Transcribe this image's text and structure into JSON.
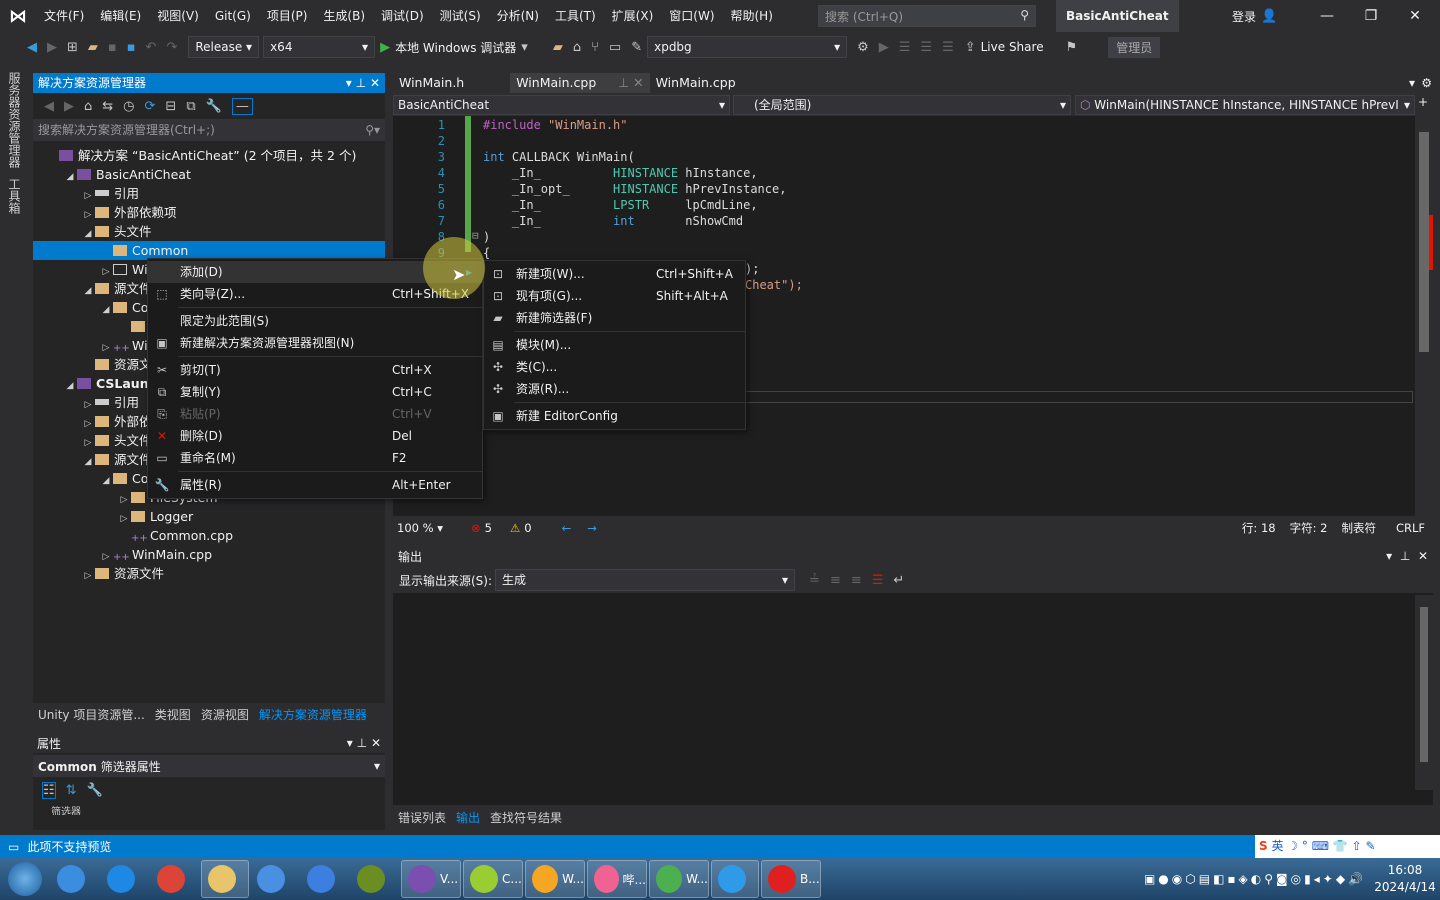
{
  "app": {
    "project_title": "BasicAntiCheat",
    "login": "登录",
    "colors": {
      "accent": "#007acc",
      "bg": "#2d2d30",
      "editor_bg": "#1e1e1e"
    }
  },
  "menu": [
    "文件(F)",
    "编辑(E)",
    "视图(V)",
    "Git(G)",
    "项目(P)",
    "生成(B)",
    "调试(D)",
    "测试(S)",
    "分析(N)",
    "工具(T)",
    "扩展(X)",
    "窗口(W)",
    "帮助(H)"
  ],
  "search": {
    "placeholder": "搜索 (Ctrl+Q)"
  },
  "toolbar": {
    "config": "Release",
    "platform": "x64",
    "run_label": "本地 Windows 调试器",
    "debugger": "xpdbg",
    "live_share": "Live Share",
    "admin": "管理员"
  },
  "left_tabs": [
    "服务器资源管理器",
    "工具箱"
  ],
  "solution_explorer": {
    "title": "解决方案资源管理器",
    "search_placeholder": "搜索解决方案资源管理器(Ctrl+;)",
    "items": [
      {
        "label": "解决方案 “BasicAntiCheat” (2 个项目，共 2 个)",
        "indent": 0,
        "arrow": "",
        "icon": "solution"
      },
      {
        "label": "BasicAntiCheat",
        "indent": 1,
        "arrow": "◢",
        "icon": "proj"
      },
      {
        "label": "引用",
        "indent": 2,
        "arrow": "▷",
        "icon": "ref"
      },
      {
        "label": "外部依赖项",
        "indent": 2,
        "arrow": "▷",
        "icon": "folder"
      },
      {
        "label": "头文件",
        "indent": 2,
        "arrow": "◢",
        "icon": "folder"
      },
      {
        "label": "Common",
        "indent": 3,
        "arrow": "",
        "icon": "folder",
        "selected": true
      },
      {
        "label": "Win",
        "indent": 3,
        "arrow": "▷",
        "icon": "file"
      },
      {
        "label": "源文件",
        "indent": 2,
        "arrow": "◢",
        "icon": "folder"
      },
      {
        "label": "Com",
        "indent": 3,
        "arrow": "◢",
        "icon": "folder"
      },
      {
        "label": "F",
        "indent": 4,
        "arrow": "",
        "icon": "folder"
      },
      {
        "label": "Win",
        "indent": 3,
        "arrow": "▷",
        "icon": "cpp"
      },
      {
        "label": "资源文件",
        "indent": 2,
        "arrow": "",
        "icon": "folder"
      },
      {
        "label": "CSLaunch",
        "indent": 1,
        "arrow": "◢",
        "icon": "proj",
        "bold": true
      },
      {
        "label": "引用",
        "indent": 2,
        "arrow": "▷",
        "icon": "ref"
      },
      {
        "label": "外部依赖",
        "indent": 2,
        "arrow": "▷",
        "icon": "folder"
      },
      {
        "label": "头文件",
        "indent": 2,
        "arrow": "▷",
        "icon": "folder"
      },
      {
        "label": "源文件",
        "indent": 2,
        "arrow": "◢",
        "icon": "folder"
      },
      {
        "label": "Com",
        "indent": 3,
        "arrow": "◢",
        "icon": "folder"
      },
      {
        "label": "FileSystem",
        "indent": 4,
        "arrow": "▷",
        "icon": "folder"
      },
      {
        "label": "Logger",
        "indent": 4,
        "arrow": "▷",
        "icon": "folder"
      },
      {
        "label": "Common.cpp",
        "indent": 4,
        "arrow": "",
        "icon": "cpp"
      },
      {
        "label": "WinMain.cpp",
        "indent": 3,
        "arrow": "▷",
        "icon": "cpp"
      },
      {
        "label": "资源文件",
        "indent": 2,
        "arrow": "▷",
        "icon": "folder"
      }
    ],
    "tabs": [
      "Unity 项目资源管...",
      "类视图",
      "资源视图",
      "解决方案资源管理器"
    ]
  },
  "properties": {
    "title": "属性",
    "object": "Common",
    "object_type": "筛选器属性",
    "row": "筛选器"
  },
  "editor": {
    "tabs": [
      "WinMain.h",
      "WinMain.cpp",
      "WinMain.cpp"
    ],
    "nav": [
      "BasicAntiCheat",
      "(全局范围)",
      "WinMain(HINSTANCE hInstance, HINSTANCE hPrevI"
    ],
    "line_numbers": [
      "1",
      "2",
      "3",
      "4",
      "5",
      "6",
      "7",
      "8",
      "9"
    ],
    "lines": [
      [
        [
          "mc",
          "#include "
        ],
        [
          "st",
          "\"WinMain.h\""
        ]
      ],
      [],
      [
        [
          "kw",
          "int "
        ],
        [
          "",
          "CALLBACK WinMain("
        ]
      ],
      [
        [
          "",
          "    _In_          "
        ],
        [
          "ty",
          "HINSTANCE "
        ],
        [
          "",
          "hInstance,"
        ]
      ],
      [
        [
          "",
          "    _In_opt_      "
        ],
        [
          "ty",
          "HINSTANCE "
        ],
        [
          "",
          "hPrevInstance,"
        ]
      ],
      [
        [
          "",
          "    _In_          "
        ],
        [
          "ty",
          "LPSTR     "
        ],
        [
          "",
          "lpCmdLine,"
        ]
      ],
      [
        [
          "",
          "    _In_          "
        ],
        [
          "kw",
          "int       "
        ],
        [
          "",
          "nShowCmd"
        ]
      ],
      [
        [
          "",
          ")"
        ]
      ],
      [
        [
          "",
          "{"
        ]
      ]
    ],
    "partial_lines": [
      ");",
      "Cheat\");"
    ],
    "zoom": "100 %",
    "errors": "5",
    "warnings": "0",
    "line": "行: 18",
    "char": "字符: 2",
    "tabs_mode": "制表符",
    "eol": "CRLF"
  },
  "output": {
    "title": "输出",
    "source_label": "显示输出来源(S):",
    "source_value": "生成"
  },
  "bottom_tabs": [
    "错误列表",
    "输出",
    "查找符号结果"
  ],
  "context_menu": {
    "items": [
      {
        "label": "添加(D)",
        "shortcut": "",
        "icon": "",
        "submenu": true
      },
      {
        "label": "类向导(Z)...",
        "shortcut": "Ctrl+Shift+X",
        "icon": "⬚"
      },
      {
        "sep": true
      },
      {
        "label": "限定为此范围(S)",
        "shortcut": "",
        "icon": ""
      },
      {
        "label": "新建解决方案资源管理器视图(N)",
        "shortcut": "",
        "icon": "▣"
      },
      {
        "sep": true
      },
      {
        "label": "剪切(T)",
        "shortcut": "Ctrl+X",
        "icon": "✂"
      },
      {
        "label": "复制(Y)",
        "shortcut": "Ctrl+C",
        "icon": "⧉"
      },
      {
        "label": "粘贴(P)",
        "shortcut": "Ctrl+V",
        "icon": "⎘",
        "disabled": true
      },
      {
        "label": "删除(D)",
        "shortcut": "Del",
        "icon": "✕"
      },
      {
        "label": "重命名(M)",
        "shortcut": "F2",
        "icon": "▭"
      },
      {
        "sep": true
      },
      {
        "label": "属性(R)",
        "shortcut": "Alt+Enter",
        "icon": "🔧"
      }
    ]
  },
  "submenu": {
    "items": [
      {
        "label": "新建项(W)...",
        "shortcut": "Ctrl+Shift+A",
        "icon": "⊡"
      },
      {
        "label": "现有项(G)...",
        "shortcut": "Shift+Alt+A",
        "icon": "⊡"
      },
      {
        "label": "新建筛选器(F)",
        "shortcut": "",
        "icon": "▰"
      },
      {
        "sep": true
      },
      {
        "label": "模块(M)...",
        "shortcut": "",
        "icon": "▤"
      },
      {
        "label": "类(C)...",
        "shortcut": "",
        "icon": "✣"
      },
      {
        "label": "资源(R)...",
        "shortcut": "",
        "icon": "✣"
      },
      {
        "sep": true
      },
      {
        "label": "新建 EditorConfig",
        "shortcut": "",
        "icon": "▣"
      }
    ]
  },
  "statusbar": {
    "message": "此项不支持预览",
    "ime": "英"
  },
  "taskbar": {
    "tasks": [
      {
        "label": "",
        "color": "#3b8de0"
      },
      {
        "label": "",
        "color": "#1e88e5"
      },
      {
        "label": "",
        "color": "#db4437"
      },
      {
        "label": "",
        "color": "#e8c56a",
        "btn": true
      },
      {
        "label": "",
        "color": "#4a90e2"
      },
      {
        "label": "",
        "color": "#3d7fe0"
      },
      {
        "label": "",
        "color": "#6b8e23"
      },
      {
        "label": "V...",
        "color": "#7a4fb0",
        "btn": true
      },
      {
        "label": "C...",
        "color": "#9acd32",
        "btn": true
      },
      {
        "label": "W...",
        "color": "#f5a623",
        "btn": true
      },
      {
        "label": "哔...",
        "color": "#f06292",
        "btn": true
      },
      {
        "label": "W...",
        "color": "#4caf50",
        "btn": true
      },
      {
        "label": "",
        "color": "#2f9be8",
        "btn": true
      },
      {
        "label": "B...",
        "color": "#e02020",
        "btn": true
      }
    ],
    "time": "16:08",
    "date": "2024/4/14"
  }
}
